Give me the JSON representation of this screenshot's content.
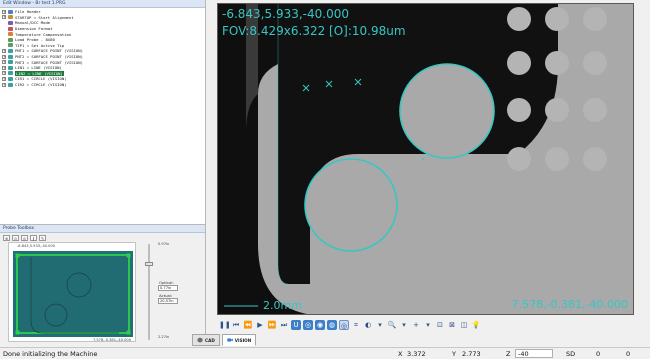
{
  "edit_window": {
    "title": "Edit Window - Br test 1.PRG",
    "items": [
      {
        "label": "File Header",
        "color": "#4d7fc4",
        "expander": "+"
      },
      {
        "label": "STARTUP = Start Alignment",
        "color": "#c8932f",
        "expander": "+"
      },
      {
        "label": "Manual/DCC Mode",
        "color": "#7c5ab3",
        "expander": ""
      },
      {
        "label": "Dimension Format",
        "color": "#d04e4e",
        "expander": ""
      },
      {
        "label": "Temperature Compensation",
        "color": "#d9813a",
        "expander": ""
      },
      {
        "label": "Load Probe - 8X80",
        "color": "#5c9d5c",
        "expander": ""
      },
      {
        "label": "TIP1 = Set Active Tip",
        "color": "#5c9d5c",
        "expander": ""
      },
      {
        "label": "PNT1 = SURFACE POINT (VISION)",
        "color": "#3aa0a0",
        "expander": "+"
      },
      {
        "label": "PNT2 = SURFACE POINT (VISION)",
        "color": "#3aa0a0",
        "expander": "+"
      },
      {
        "label": "PNT3 = SURFACE POINT (VISION)",
        "color": "#3aa0a0",
        "expander": "+"
      },
      {
        "label": "LIN1 = LINE (VISION)",
        "color": "#3aa0a0",
        "expander": "+"
      },
      {
        "label": "LIN2 = LINE (VISION)",
        "color": "#3aa0a0",
        "expander": "+",
        "selected": true
      },
      {
        "label": "CIR1 = CIRCLE (VISION)",
        "color": "#3aa0a0",
        "expander": "+"
      },
      {
        "label": "CIR2 = CIRCLE (VISION)",
        "color": "#3aa0a0",
        "expander": "+"
      }
    ]
  },
  "probe_toolbox": {
    "title": "Probe Toolbox",
    "tabs": [
      "⊕",
      "⊙",
      "◎",
      "∥",
      "✎"
    ],
    "top_coord": "-6.843,5.933,-40.000",
    "bottom_coord": "7.578,-0.381,-40.000",
    "top_value": "0.97in",
    "bottom_value": "2.27in",
    "optical_label": "Optical:",
    "optical_value": "0.77in",
    "actual_label": "Actual:",
    "actual_value": "20.57in"
  },
  "video": {
    "dro_text": "-6.843,5.933,-40.000",
    "fov_text": "FOV:8.429x6.322   [O]:10.98um",
    "scale_text": "2.0mm",
    "cursor_text": "7.578,-0.381,-40.000",
    "colors": {
      "background": "#0f0f0f",
      "part": "#a9a9a9",
      "overlay": "#38c6c2"
    }
  },
  "toolbar": {
    "buttons": [
      {
        "name": "pause-icon",
        "glyph": "❚❚",
        "style": "plain"
      },
      {
        "name": "rewind-start-icon",
        "glyph": "⏮",
        "style": "plain"
      },
      {
        "name": "rewind-icon",
        "glyph": "⏪",
        "style": "plain"
      },
      {
        "name": "play-icon",
        "glyph": "▶",
        "style": "plain"
      },
      {
        "name": "fast-forward-icon",
        "glyph": "⏩",
        "style": "plain"
      },
      {
        "name": "step-forward-icon",
        "glyph": "⏭",
        "style": "plain"
      },
      {
        "name": "magnet-icon",
        "glyph": "U",
        "style": "blue"
      },
      {
        "name": "target-icon",
        "glyph": "◎",
        "style": "blue"
      },
      {
        "name": "circle-target-icon",
        "glyph": "◉",
        "style": "blue"
      },
      {
        "name": "edge-icon",
        "glyph": "◍",
        "style": "blue"
      },
      {
        "name": "gage-icon",
        "glyph": "◎",
        "style": "pressed"
      },
      {
        "name": "crosshair-icon",
        "glyph": "⌗",
        "style": "plain"
      },
      {
        "name": "contrast-icon",
        "glyph": "◐",
        "style": "plain"
      },
      {
        "name": "dropdown-icon",
        "glyph": "▾",
        "style": "plain"
      },
      {
        "name": "zoom-icon",
        "glyph": "🔍",
        "style": "plain"
      },
      {
        "name": "zoom-dropdown-icon",
        "glyph": "▾",
        "style": "plain"
      },
      {
        "name": "plus-icon",
        "glyph": "+",
        "style": "plain"
      },
      {
        "name": "plus-dropdown-icon",
        "glyph": "▾",
        "style": "plain"
      },
      {
        "name": "zoom-fit-icon",
        "glyph": "⊡",
        "style": "plain"
      },
      {
        "name": "find-icon",
        "glyph": "⊠",
        "style": "plain"
      },
      {
        "name": "camera-icon",
        "glyph": "◫",
        "style": "plain"
      },
      {
        "name": "lightbulb-icon",
        "glyph": "💡",
        "style": "plain"
      }
    ]
  },
  "tabs": {
    "cad_label": "CAD",
    "vision_label": "VISION"
  },
  "status_bar": {
    "message": "Done initializing the Machine",
    "x_label": "X",
    "x_value": "3.372",
    "y_label": "Y",
    "y_value": "2.773",
    "z_label": "Z",
    "z_value": "-40",
    "sd_label": "SD",
    "sd_value": "0",
    "extra_value": "0"
  }
}
